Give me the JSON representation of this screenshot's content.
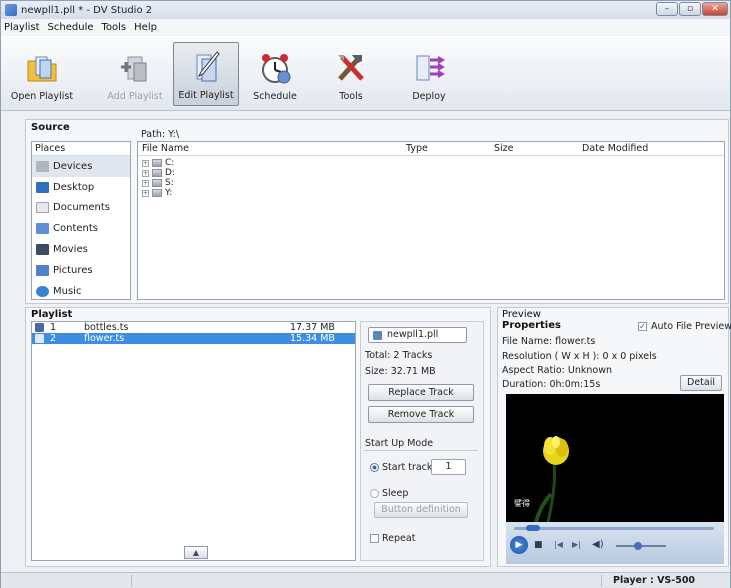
{
  "window": {
    "title": "newpll1.pll * - DV Studio 2",
    "min": "–",
    "max": "▫",
    "close": "✕"
  },
  "menu": [
    "Playlist",
    "Schedule",
    "Tools",
    "Help"
  ],
  "toolbar": {
    "open": "Open Playlist",
    "add": "Add Playlist",
    "edit": "Edit Playlist",
    "schedule": "Schedule",
    "tools": "Tools",
    "deploy": "Deploy"
  },
  "source": {
    "title": "Source",
    "path": "Path: Y:\\",
    "places_header": "Places",
    "places": [
      "Devices",
      "Desktop",
      "Documents",
      "Contents",
      "Movies",
      "Pictures",
      "Music"
    ],
    "columns": [
      "File Name",
      "Type",
      "Size",
      "Date Modified"
    ],
    "files": [
      "C:",
      "D:",
      "S:",
      "Y:"
    ]
  },
  "playlist": {
    "title": "Playlist",
    "rows": [
      {
        "num": "1",
        "name": "bottles.ts",
        "size": "17.37 MB"
      },
      {
        "num": "2",
        "name": "flower.ts",
        "size": "15.34 MB"
      }
    ],
    "file": "newpll1.pll",
    "total": "Total: 2 Tracks",
    "size": "Size: 32.71 MB",
    "replace": "Replace Track",
    "remove": "Remove Track",
    "startup": "Start Up Mode",
    "start_track": "Start track",
    "start_value": "1",
    "sleep": "Sleep",
    "button_def": "Button definition",
    "repeat": "Repeat"
  },
  "preview": {
    "title": "Preview",
    "props": "Properties",
    "auto": "Auto File Preview",
    "filename": "File Name: flower.ts",
    "resolution": "Resolution ( W x H ): 0 x 0 pixels",
    "aspect": "Aspect Ratio: Unknown",
    "duration": "Duration: 0h:0m:15s",
    "detail": "Detail",
    "caption": "譬得"
  },
  "status": {
    "player": "Player : VS-500"
  }
}
